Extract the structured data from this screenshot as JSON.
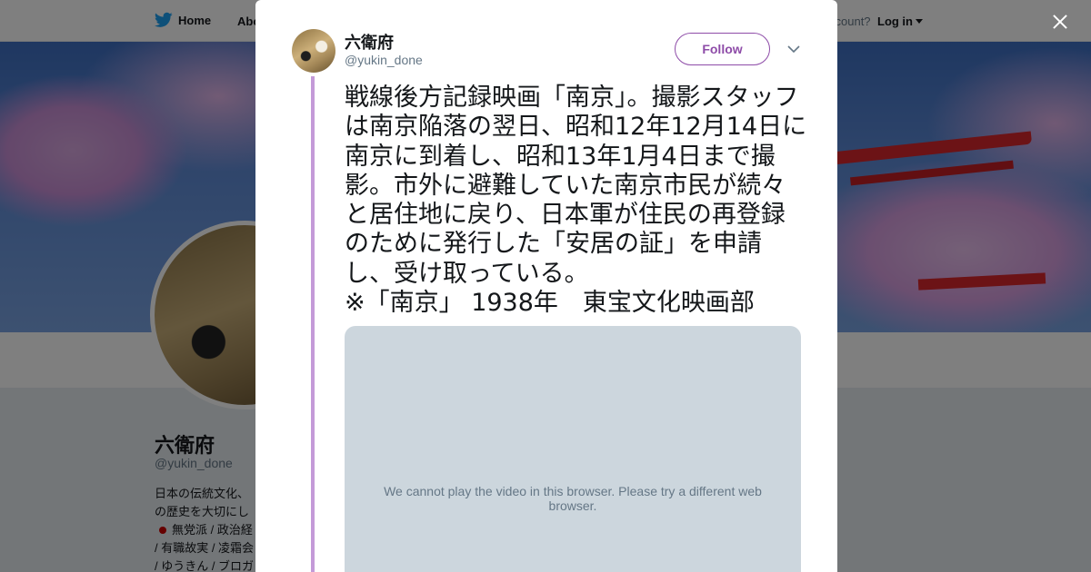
{
  "nav": {
    "home_label": "Home",
    "about_label": "Abo",
    "account_prompt": "ccount?",
    "login_label": "Log in"
  },
  "profile": {
    "name": "六衛府",
    "handle": "@yukin_done",
    "bio_lines": [
      "日本の伝統文化、",
      "の歴史を大切にし",
      "無党派 / 政治経",
      "/ 有職故実 / 凌霜会",
      "/ ゆうきん / ブロガ"
    ]
  },
  "tweet": {
    "author_name": "六衛府",
    "author_handle": "@yukin_done",
    "follow_label": "Follow",
    "text": "戦線後方記録映画「南京」。撮影スタッフは南京陥落の翌日、昭和12年12月14日に南京に到着し、昭和13年1月4日まで撮影。市外に避難していた南京市民が続々と居住地に戻り、日本軍が住民の再登録のために発行した「安居の証」を申請し、受け取っている。\n※「南京」 1938年　東宝文化映画部",
    "video_message": "We cannot play the video in this browser. Please try a different web browser."
  },
  "colors": {
    "accent": "#8e4ca8",
    "thread_line": "#c49ad8",
    "twitter_blue": "#1da1f2",
    "video_bg": "#ccd6dd"
  },
  "icons": {
    "logo": "twitter-bird-icon",
    "close": "close-icon",
    "more": "chevron-down-icon"
  }
}
